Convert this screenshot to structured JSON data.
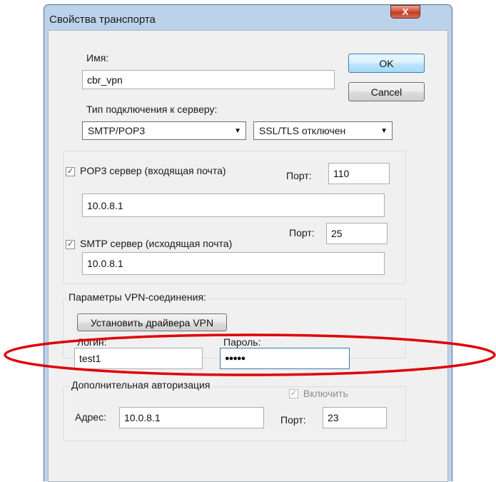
{
  "window": {
    "title": "Свойства транспорта",
    "close_label": "X"
  },
  "name": {
    "label": "Имя:",
    "value": "cbr_vpn"
  },
  "buttons": {
    "ok": "OK",
    "cancel": "Cancel"
  },
  "connection": {
    "label": "Тип подключения к серверу:",
    "type_value": "SMTP/POP3",
    "ssl_value": "SSL/TLS отключен"
  },
  "pop3": {
    "checked": true,
    "label": "POP3 сервер (входящая почта)",
    "port_label": "Порт:",
    "port": "110",
    "host": "10.0.8.1"
  },
  "smtp": {
    "checked": true,
    "label": "SMTP сервер (исходящая почта)",
    "port_label": "Порт:",
    "port": "25",
    "host": "10.0.8.1"
  },
  "vpn": {
    "group_label": "Параметры VPN-соединения:",
    "install_button": "Установить драйвера VPN",
    "login_label": "Логин:",
    "login_value": "test1",
    "password_label": "Пароль:",
    "password_value": "●●●●●"
  },
  "auth": {
    "group_label": "Дополнительная авторизация",
    "enable_label": "Включить",
    "enable_checked": true,
    "address_label": "Адрес:",
    "address_value": "10.0.8.1",
    "port_label": "Порт:",
    "port_value": "23"
  },
  "icons": {
    "check": "✓",
    "dropdown": "▼"
  },
  "colors": {
    "annotation": "#e00000",
    "frame": "#bcd2ea",
    "dialog_bg": "#f0f0f0"
  }
}
